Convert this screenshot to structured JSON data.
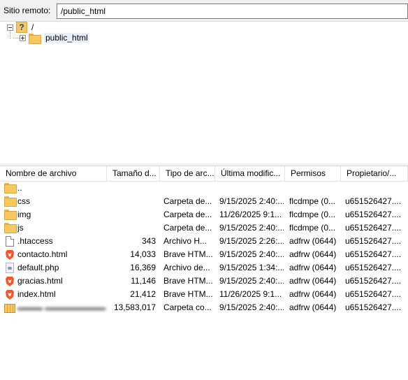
{
  "remote": {
    "label": "Sitio remoto:",
    "path": "/public_html"
  },
  "tree": {
    "root_label": "/",
    "child_label": "public_html"
  },
  "columns": [
    "Nombre de archivo",
    "Tamaño d...",
    "Tipo de arc...",
    "Última modific...",
    "Permisos",
    "Propietario/..."
  ],
  "files": [
    {
      "icon": "folder-icon",
      "name": "..",
      "size": "",
      "type": "",
      "modified": "",
      "perms": "",
      "owner": ""
    },
    {
      "icon": "folder-icon",
      "name": "css",
      "size": "",
      "type": "Carpeta de...",
      "modified": "9/15/2025 2:40:...",
      "perms": "flcdmpe (0...",
      "owner": "u651526427...."
    },
    {
      "icon": "folder-icon",
      "name": "img",
      "size": "",
      "type": "Carpeta de...",
      "modified": "11/26/2025 9:1...",
      "perms": "flcdmpe (0...",
      "owner": "u651526427...."
    },
    {
      "icon": "folder-icon",
      "name": "js",
      "size": "",
      "type": "Carpeta de...",
      "modified": "9/15/2025 2:40:...",
      "perms": "flcdmpe (0...",
      "owner": "u651526427...."
    },
    {
      "icon": "file-icon",
      "name": ".htaccess",
      "size": "343",
      "type": "Archivo H...",
      "modified": "9/15/2025 2:26:...",
      "perms": "adfrw (0644)",
      "owner": "u651526427...."
    },
    {
      "icon": "brave-html-icon",
      "name": "contacto.html",
      "size": "14,033",
      "type": "Brave HTM...",
      "modified": "9/15/2025 2:40:...",
      "perms": "adfrw (0644)",
      "owner": "u651526427...."
    },
    {
      "icon": "php-file-icon",
      "name": "default.php",
      "size": "16,369",
      "type": "Archivo de...",
      "modified": "9/15/2025 1:34:...",
      "perms": "adfrw (0644)",
      "owner": "u651526427...."
    },
    {
      "icon": "brave-html-icon",
      "name": "gracias.html",
      "size": "11,146",
      "type": "Brave HTM...",
      "modified": "9/15/2025 2:40:...",
      "perms": "adfrw (0644)",
      "owner": "u651526427...."
    },
    {
      "icon": "brave-html-icon",
      "name": "index.html",
      "size": "21,412",
      "type": "Brave HTM...",
      "modified": "11/26/2025 9:1...",
      "perms": "adfrw (0644)",
      "owner": "u651526427...."
    },
    {
      "icon": "archive-icon",
      "name": "",
      "size": "13,583,017",
      "type": "Carpeta co...",
      "modified": "9/15/2025 2:40:...",
      "perms": "adfrw (0644)",
      "owner": "u651526427...."
    }
  ],
  "colors": {
    "folder": "#f6c85f",
    "brave": "#fb542b"
  }
}
